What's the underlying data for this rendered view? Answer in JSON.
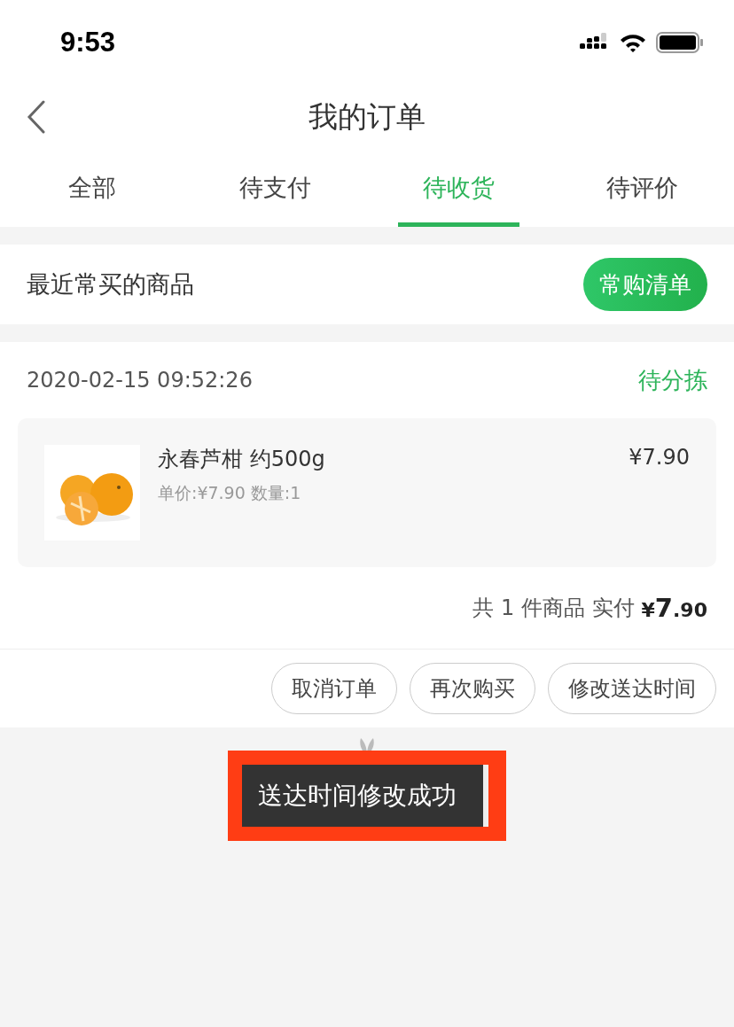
{
  "status_bar": {
    "time": "9:53"
  },
  "header": {
    "title": "我的订单"
  },
  "tabs": [
    {
      "label": "全部",
      "selected": false
    },
    {
      "label": "待支付",
      "selected": false
    },
    {
      "label": "待收货",
      "selected": true
    },
    {
      "label": "待评价",
      "selected": false
    }
  ],
  "recent": {
    "label": "最近常买的商品",
    "button": "常购清单"
  },
  "order": {
    "time": "2020-02-15 09:52:26",
    "status": "待分拣",
    "items": [
      {
        "kind": "picture",
        "name": "永春芦柑 约500g",
        "detail": "单价:¥7.90 数量:1",
        "price": "¥7.90"
      }
    ],
    "summary": "共 1 件商品 实付",
    "total_symbol": "¥",
    "total_int": "7",
    "total_dec": ".90",
    "buttons": [
      "取消订单",
      "再次购买",
      "修改送达时间"
    ]
  },
  "toast": {
    "text": "送达时间修改成功"
  }
}
